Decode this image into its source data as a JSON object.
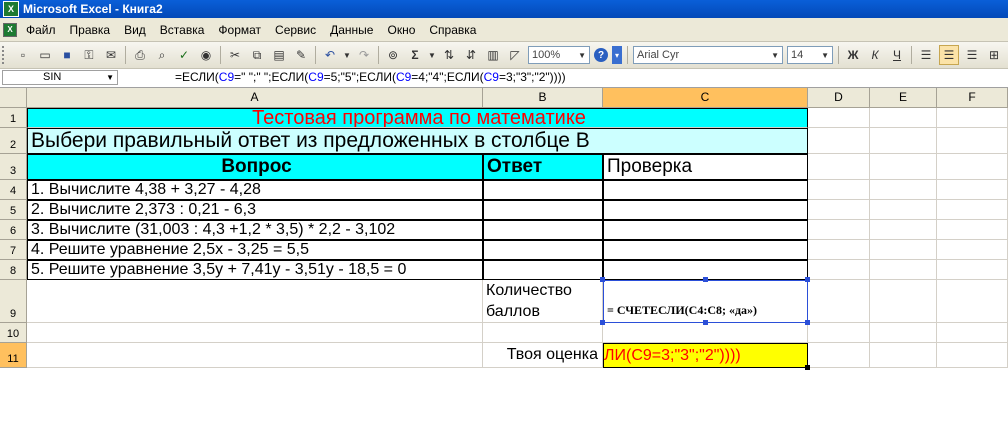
{
  "window": {
    "title": "Microsoft Excel - Книга2"
  },
  "menu": [
    "Файл",
    "Правка",
    "Вид",
    "Вставка",
    "Формат",
    "Сервис",
    "Данные",
    "Окно",
    "Справка"
  ],
  "toolbar": {
    "zoom": "100%",
    "font": "Arial Cyr",
    "size": "14",
    "bold": "Ж",
    "italic": "К",
    "underline": "Ч",
    "sum": "Σ"
  },
  "formula_bar": {
    "name_box": "SIN",
    "parts": [
      {
        "t": "=ЕСЛИ(",
        "ref": false
      },
      {
        "t": "C9",
        "ref": true
      },
      {
        "t": "=\" \";\" \";ЕСЛИ(",
        "ref": false
      },
      {
        "t": "C9",
        "ref": true
      },
      {
        "t": "=5;\"5\";ЕСЛИ(",
        "ref": false
      },
      {
        "t": "C9",
        "ref": true
      },
      {
        "t": "=4;\"4\";ЕСЛИ(",
        "ref": false
      },
      {
        "t": "C9",
        "ref": true
      },
      {
        "t": "=3;\"3\";\"2\"))))",
        "ref": false
      }
    ]
  },
  "columns": [
    "A",
    "B",
    "C",
    "D",
    "E",
    "F"
  ],
  "rows": [
    "1",
    "2",
    "3",
    "4",
    "5",
    "6",
    "7",
    "8",
    "9",
    "10",
    "11"
  ],
  "cells": {
    "A1": "Тестовая программа по математике",
    "A2": "Выбери правильный ответ из предложенных в столбце В",
    "A3": "Вопрос",
    "B3": "Ответ",
    "C3": "Проверка",
    "A4": "1. Вычислите 4,38 + 3,27 - 4,28",
    "A5": "2. Вычислите 2,373 : 0,21 - 6,3",
    "A6": "3. Вычислите (31,003 : 4,3 +1,2 * 3,5) * 2,2 - 3,102",
    "A7": "4. Решите уравнение 2,5х - 3,25 = 5,5",
    "A8": "5. Решите уравнение 3,5у + 7,41у - 3,51у - 18,5 = 0",
    "B9_line1": "Количество",
    "B9_line2": "баллов",
    "C9": "= СЧЕТЕСЛИ(C4:C8; «да»)",
    "B11": "Твоя оценка",
    "C11": "ЛИ(C9=3;\"3\";\"2\"))))"
  },
  "colors": {
    "cyan_fill": "#00ffff",
    "light_cyan_fill": "#ccffff",
    "yellow_fill": "#ffff00",
    "title_red": "#ff0000",
    "selected_header": "#ffc05e"
  }
}
